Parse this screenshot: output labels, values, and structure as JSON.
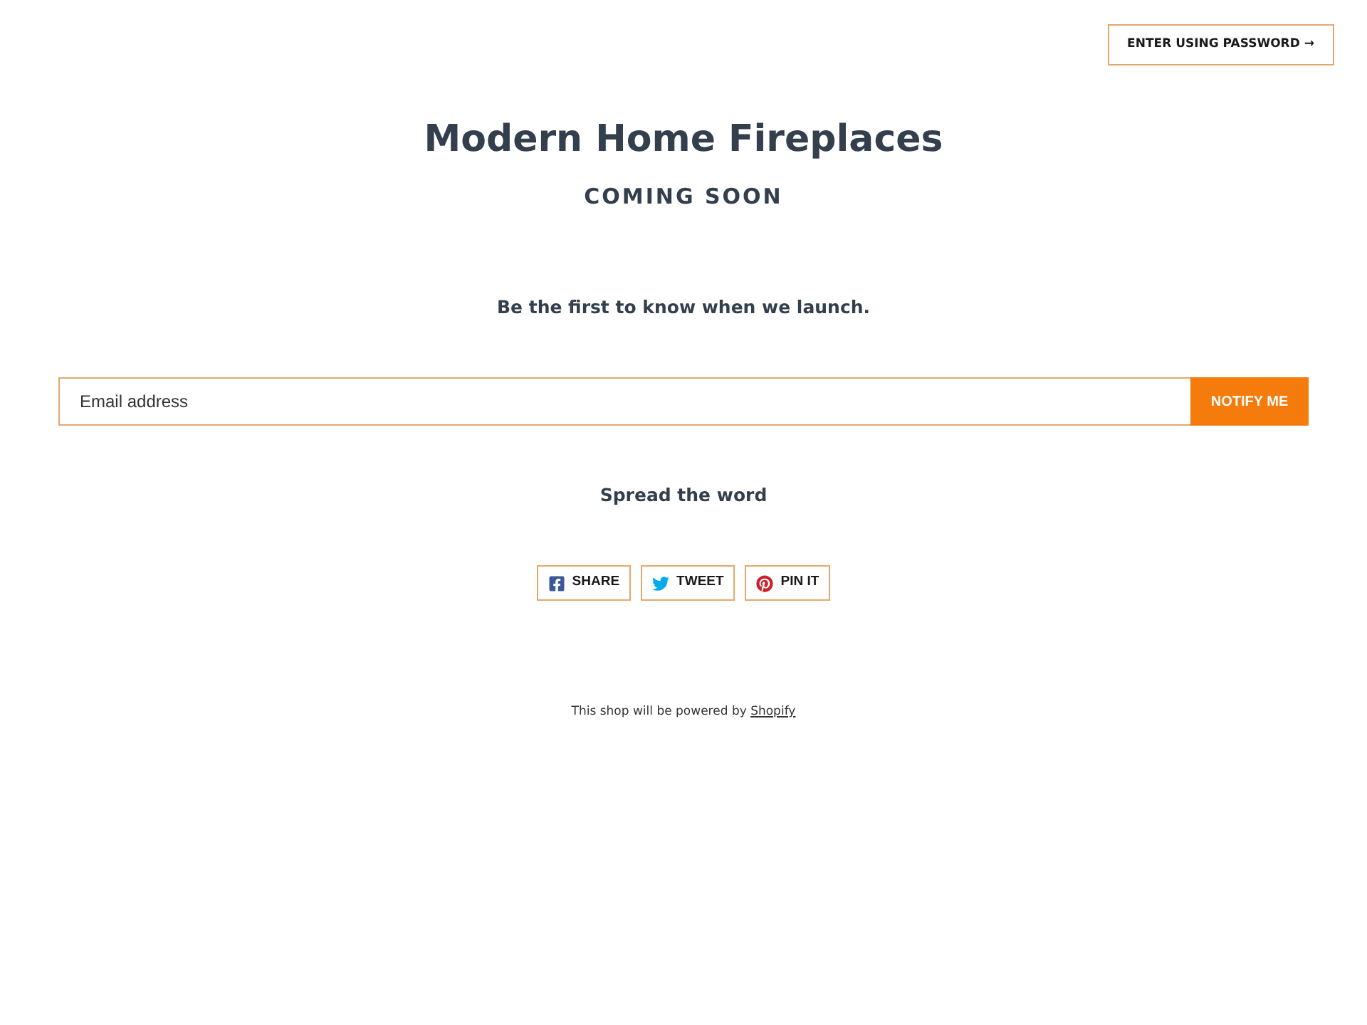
{
  "header": {
    "password_button": "ENTER USING PASSWORD →"
  },
  "title": "Modern Home Fireplaces",
  "subtitle": "COMING SOON",
  "tagline": "Be the first to know when we launch.",
  "signup": {
    "placeholder": "Email address",
    "button": "NOTIFY ME"
  },
  "share": {
    "heading": "Spread the word",
    "buttons": [
      {
        "kind": "facebook",
        "label": "SHARE"
      },
      {
        "kind": "twitter",
        "label": "TWEET"
      },
      {
        "kind": "pinterest",
        "label": "PIN IT"
      }
    ]
  },
  "footer": {
    "text": "This shop will be powered by",
    "link": "Shopify"
  }
}
